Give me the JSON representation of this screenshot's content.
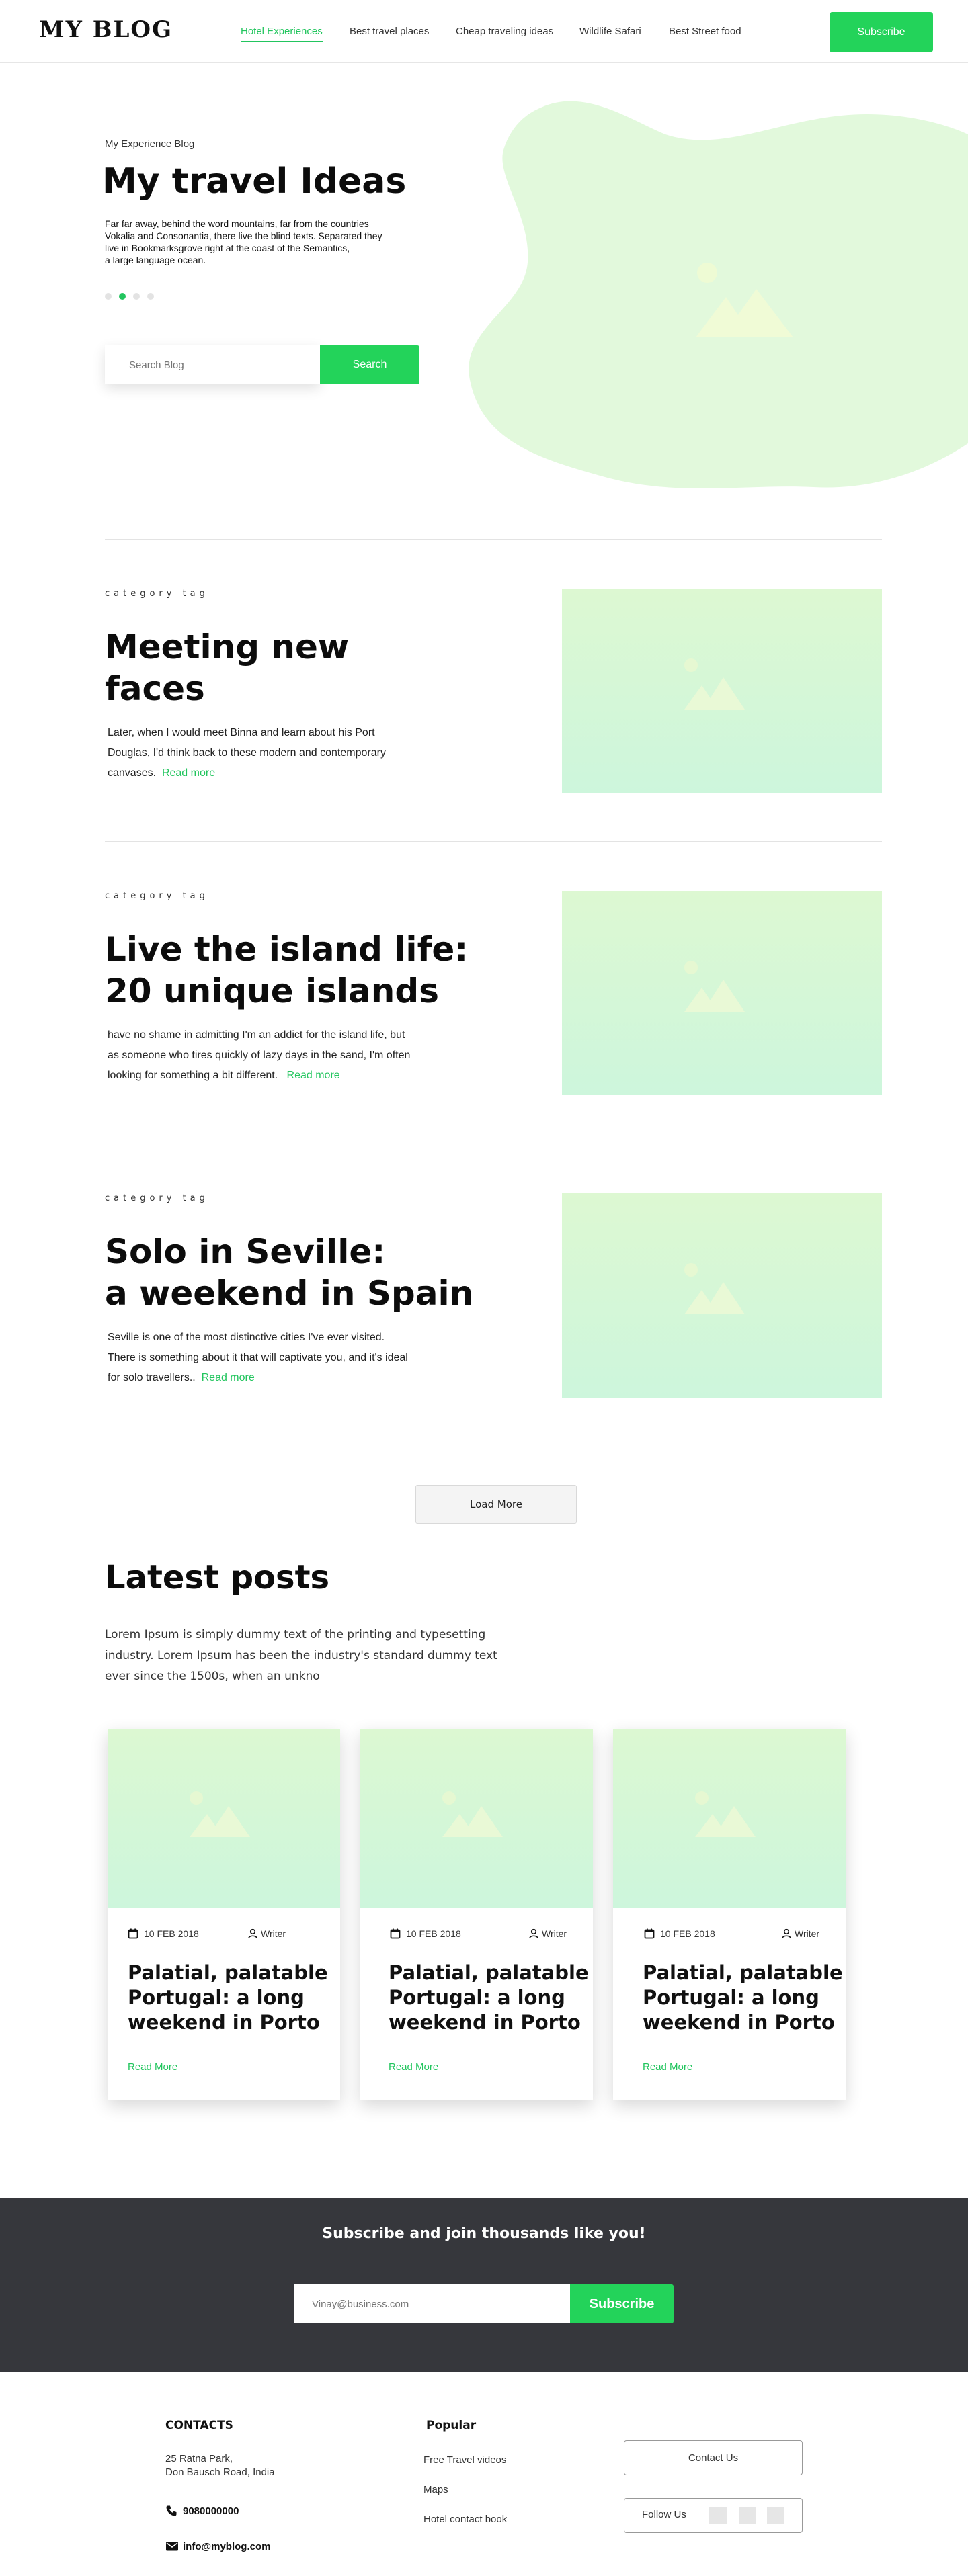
{
  "header": {
    "logo": "MY BLOG",
    "nav": [
      {
        "label": "Hotel Experiences",
        "active": true
      },
      {
        "label": "Best travel places"
      },
      {
        "label": "Cheap traveling ideas"
      },
      {
        "label": "Wildlife Safari"
      },
      {
        "label": "Best Street food"
      }
    ],
    "subscribe_label": "Subscribe"
  },
  "hero": {
    "eyebrow": "My Experience Blog",
    "title": "My travel Ideas",
    "text_lines": [
      "Far far away, behind the word mountains, far from the countries",
      "Vokalia and Consonantia, there live the blind texts. Separated they",
      "live in Bookmarksgrove right at the coast of the Semantics,",
      "a large language ocean."
    ],
    "slides_total": 4,
    "active_slide": 2,
    "search_placeholder": "Search Blog",
    "search_label": "Search"
  },
  "posts": [
    {
      "tag": "category tag",
      "title_lines": [
        "Meeting new",
        "faces"
      ],
      "excerpt_lines": [
        "Later, when I would meet Binna and learn about his Port",
        "Douglas, I'd think back to these modern and contemporary",
        "canvases."
      ],
      "read_more": "Read more"
    },
    {
      "tag": "category tag",
      "title_lines": [
        "Live the island life:",
        "20 unique islands"
      ],
      "excerpt_lines": [
        " have no shame in admitting I'm an addict for the island life, but",
        "as someone who tires quickly of lazy days in the sand, I'm often",
        "looking for something a bit different."
      ],
      "read_more": "Read more"
    },
    {
      "tag": "category tag",
      "title_lines": [
        "Solo in Seville:",
        "a weekend in Spain"
      ],
      "excerpt_lines": [
        "Seville is one of the most distinctive cities I've ever visited.",
        "There is something about it that will captivate you, and it's ideal",
        "for solo travellers.."
      ],
      "read_more": "Read more"
    }
  ],
  "load_more": "Load More",
  "latest": {
    "title": "Latest posts",
    "text_lines": [
      "Lorem Ipsum is simply dummy text of the printing and typesetting",
      "industry. Lorem Ipsum has been the industry's standard dummy text",
      "ever since the 1500s, when an unkno"
    ],
    "cards": [
      {
        "date": "10 FEB 2018",
        "author": "Writer",
        "title_lines": [
          "Palatial, palatable",
          "Portugal: a long",
          "weekend in Porto"
        ],
        "read_more": "Read More"
      },
      {
        "date": "10 FEB 2018",
        "author": "Writer",
        "title_lines": [
          "Palatial, palatable",
          "Portugal: a long",
          "weekend in Porto"
        ],
        "read_more": "Read More"
      },
      {
        "date": "10 FEB 2018",
        "author": "Writer",
        "title_lines": [
          "Palatial, palatable",
          "Portugal: a long",
          "weekend in Porto"
        ],
        "read_more": "Read More"
      }
    ]
  },
  "subscribe": {
    "title": "Subscribe and join thousands like you!",
    "placeholder": "Vinay@business.com",
    "button": "Subscribe"
  },
  "footer": {
    "contacts_title": "CONTACTS",
    "address_lines": [
      "25 Ratna Park,",
      "Don Bausch Road, India"
    ],
    "phone": "9080000000",
    "email": "info@myblog.com",
    "popular_title": "Popular",
    "popular": [
      "Free  Travel videos",
      "Maps",
      "Hotel contact book"
    ],
    "contact_us": "Contact Us",
    "follow_us": "Follow Us"
  },
  "colors": {
    "accent": "#22c55e",
    "button_green": "#23d35a",
    "blob": "#e2f9dc",
    "band": "#36373c"
  }
}
